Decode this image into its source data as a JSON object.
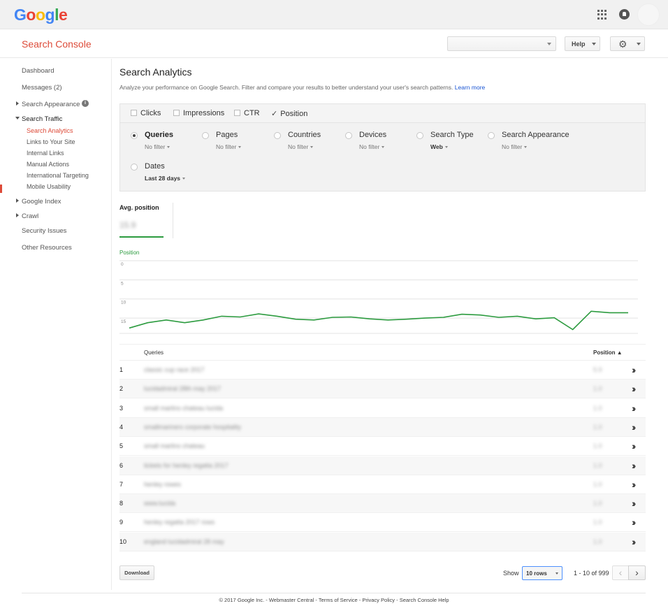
{
  "google_logo": [
    "G",
    "o",
    "o",
    "g",
    "l",
    "e"
  ],
  "logo_colors": [
    "#4285f4",
    "#ea4335",
    "#fbbc05",
    "#4285f4",
    "#34a853",
    "#ea4335"
  ],
  "header": {
    "title": "Search Console",
    "site_select_value": "",
    "help_label": "Help"
  },
  "sidebar": {
    "dashboard": "Dashboard",
    "messages": "Messages (2)",
    "search_appearance": "Search Appearance",
    "search_traffic": "Search Traffic",
    "search_analytics": "Search Analytics",
    "links_to_your_site": "Links to Your Site",
    "internal_links": "Internal Links",
    "manual_actions": "Manual Actions",
    "international_targeting": "International Targeting",
    "mobile_usability": "Mobile Usability",
    "google_index": "Google Index",
    "crawl": "Crawl",
    "security_issues": "Security Issues",
    "other_resources": "Other Resources"
  },
  "page": {
    "title": "Search Analytics",
    "description": "Analyze your performance on Google Search. Filter and compare your results to better understand your user's search patterns.",
    "learn_more": "Learn more"
  },
  "metrics": {
    "clicks": "Clicks",
    "impressions": "Impressions",
    "ctr": "CTR",
    "position": "Position",
    "clicks_checked": false,
    "impressions_checked": false,
    "ctr_checked": false,
    "position_checked": true
  },
  "filters": {
    "queries": {
      "label": "Queries",
      "value": "No filter"
    },
    "pages": {
      "label": "Pages",
      "value": "No filter"
    },
    "countries": {
      "label": "Countries",
      "value": "No filter"
    },
    "devices": {
      "label": "Devices",
      "value": "No filter"
    },
    "search_type": {
      "label": "Search Type",
      "value": "Web"
    },
    "search_appearance": {
      "label": "Search Appearance",
      "value": "No filter"
    },
    "dates": {
      "label": "Dates",
      "value": "Last 28 days"
    },
    "selected": "queries"
  },
  "summary": {
    "label": "Avg. position",
    "value": "15.9"
  },
  "chart_data": {
    "type": "line",
    "title": "Position",
    "y_ticks": [
      "0",
      "5",
      "10",
      "15"
    ],
    "ylim": [
      0,
      19
    ],
    "y_inverted": true,
    "series": [
      {
        "name": "Position",
        "color": "#2c9b3f",
        "values": [
          17.6,
          16.2,
          15.5,
          16.2,
          15.5,
          14.5,
          14.7,
          13.9,
          14.5,
          15.3,
          15.5,
          14.8,
          14.7,
          15.2,
          15.5,
          15.3,
          15.0,
          14.8,
          14.0,
          14.2,
          14.8,
          14.5,
          15.2,
          14.9,
          18.0,
          13.2,
          13.6,
          13.6
        ]
      }
    ]
  },
  "table": {
    "col_query": "Queries",
    "col_position": "Position ▲",
    "rows": [
      {
        "num": "1",
        "query": "classic cup race 2017",
        "position": "5.9"
      },
      {
        "num": "2",
        "query": "lucidadmiral 28th may 2017",
        "position": "1.0"
      },
      {
        "num": "3",
        "query": "small marlins chateau lucida",
        "position": "1.0"
      },
      {
        "num": "4",
        "query": "smallmariners corporate hospitality",
        "position": "1.0"
      },
      {
        "num": "5",
        "query": "small marlins chateau",
        "position": "1.0"
      },
      {
        "num": "6",
        "query": "tickets for henley regatta 2017",
        "position": "1.0"
      },
      {
        "num": "7",
        "query": "henley rowes",
        "position": "1.0"
      },
      {
        "num": "8",
        "query": "www.lucida",
        "position": "1.0"
      },
      {
        "num": "9",
        "query": "henley regatta 2017 rows",
        "position": "1.0"
      },
      {
        "num": "10",
        "query": "england lucidadmiral 28 may",
        "position": "1.0"
      }
    ]
  },
  "pagination": {
    "download": "Download",
    "show": "Show",
    "rows_value": "10 rows",
    "range": "1 - 10 of 999",
    "prev": "‹",
    "next": "›"
  },
  "footer": {
    "text": "© 2017 Google Inc. - Webmaster Central - Terms of Service - Privacy Policy - Search Console Help"
  }
}
